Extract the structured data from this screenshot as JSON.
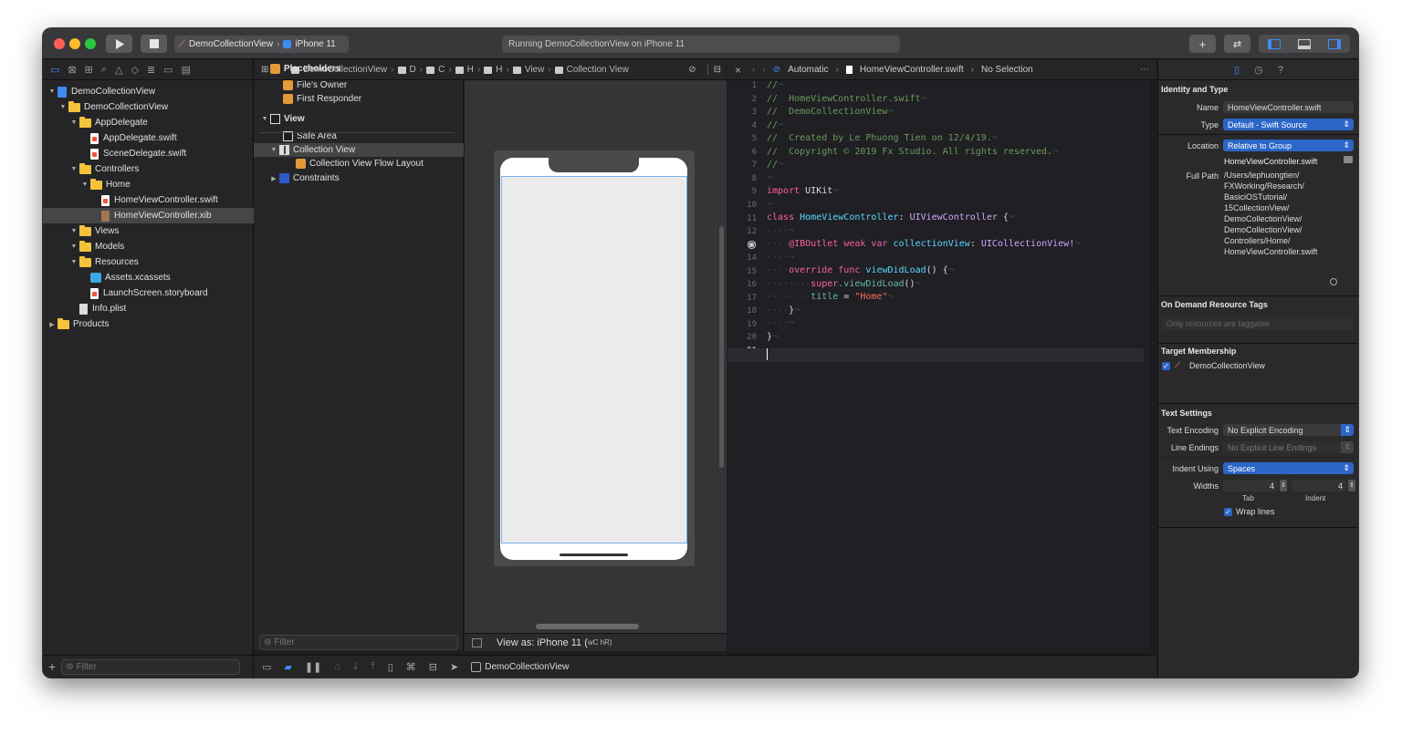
{
  "toolbar": {
    "scheme": "DemoCollectionView",
    "device": "iPhone 11",
    "status": "Running DemoCollectionView on iPhone 11",
    "add_label": "+",
    "play_icon": "play-icon",
    "stop_icon": "stop-icon"
  },
  "navigator": {
    "items": [
      {
        "label": "DemoCollectionView",
        "kind": "project"
      },
      {
        "label": "DemoCollectionView",
        "kind": "folder"
      },
      {
        "label": "AppDelegate",
        "kind": "folder"
      },
      {
        "label": "AppDelegate.swift",
        "kind": "swift"
      },
      {
        "label": "SceneDelegate.swift",
        "kind": "swift"
      },
      {
        "label": "Controllers",
        "kind": "folder"
      },
      {
        "label": "Home",
        "kind": "folder"
      },
      {
        "label": "HomeViewController.swift",
        "kind": "swift"
      },
      {
        "label": "HomeViewController.xib",
        "kind": "xib",
        "selected": true
      },
      {
        "label": "Views",
        "kind": "folder"
      },
      {
        "label": "Models",
        "kind": "folder"
      },
      {
        "label": "Resources",
        "kind": "folder"
      },
      {
        "label": "Assets.xcassets",
        "kind": "assets"
      },
      {
        "label": "LaunchScreen.storyboard",
        "kind": "swift"
      },
      {
        "label": "Info.plist",
        "kind": "plist"
      },
      {
        "label": "Products",
        "kind": "folder"
      }
    ],
    "filter_placeholder": "Filter"
  },
  "ib": {
    "breadcrumb": [
      "DemoCollectionView",
      "D",
      "C",
      "H",
      "H",
      "View",
      "Collection View"
    ],
    "outline": [
      {
        "label": "Placeholders",
        "bold": true
      },
      {
        "label": "File's Owner"
      },
      {
        "label": "First Responder"
      },
      {
        "label": "View",
        "bold": true
      },
      {
        "label": "Safe Area"
      },
      {
        "label": "Collection View",
        "selected": true
      },
      {
        "label": "Collection View Flow Layout"
      },
      {
        "label": "Constraints"
      }
    ],
    "filter_placeholder": "Filter",
    "view_as": "View as: iPhone 11 (",
    "view_as_size": "wC hR)"
  },
  "editor": {
    "jump_mode": "Automatic",
    "file": "HomeViewController.swift",
    "selection": "No Selection",
    "line_numbers": [
      "1",
      "2",
      "3",
      "4",
      "5",
      "6",
      "7",
      "8",
      "9",
      "10",
      "11",
      "12",
      "13",
      "14",
      "15",
      "16",
      "17",
      "18",
      "19",
      "20",
      "21"
    ],
    "comments": {
      "l1": "//",
      "l2": "//  HomeViewController.swift",
      "l3": "//  DemoCollectionView",
      "l4": "//",
      "l5": "//  Created by Le Phuong Tien on 12/4/19.",
      "l6": "//  Copyright © 2019 Fx Studio. All rights reserved.",
      "l7": "//"
    },
    "code": {
      "import_kw": "import",
      "import_mod": "UIKit",
      "class_kw": "class",
      "class_name": "HomeViewController",
      "super_class": "UIViewController",
      "brace_open": " {",
      "outlet": "@IBOutlet",
      "weak_var": "weak var",
      "outlet_name": "collectionView",
      "outlet_type": "UICollectionView!",
      "override_func": "override func",
      "method": "viewDidLoad",
      "parens": "() {",
      "super_kw": "super",
      "super_call": ".viewDidLoad",
      "call_parens": "()",
      "title_prop": "title",
      "assign": " = ",
      "title_value": "\"Home\"",
      "close_inner": "}",
      "close_outer": "}"
    }
  },
  "inspector": {
    "identity_header": "Identity and Type",
    "name_label": "Name",
    "name_value": "HomeViewController.swift",
    "type_label": "Type",
    "type_value": "Default - Swift Source",
    "location_label": "Location",
    "location_value": "Relative to Group",
    "location_file": "HomeViewController.swift",
    "full_path_label": "Full Path",
    "full_path": [
      "/Users/lephuongtien/",
      "FXWorking/Research/",
      "BasiciOSTutorial/",
      "15CollectionView/",
      "DemoCollectionView/",
      "DemoCollectionView/",
      "Controllers/Home/",
      "HomeViewController.swift"
    ],
    "odr_header": "On Demand Resource Tags",
    "odr_placeholder": "Only resources are taggable",
    "membership_header": "Target Membership",
    "membership_target": "DemoCollectionView",
    "text_header": "Text Settings",
    "encoding_label": "Text Encoding",
    "encoding_value": "No Explicit Encoding",
    "endings_label": "Line Endings",
    "endings_value": "No Explicit Line Endings",
    "indent_label": "Indent Using",
    "indent_value": "Spaces",
    "widths_label": "Widths",
    "tab_value": "4",
    "indent_width_value": "4",
    "tab_label": "Tab",
    "indent_sub_label": "Indent",
    "wrap_label": "Wrap lines"
  },
  "bottom": {
    "target": "DemoCollectionView"
  },
  "colors": {
    "accent": "#2c66c8",
    "keyword": "#fc5fa3",
    "comment": "#6c9c5a",
    "type": "#5dd8ff",
    "string": "#fc6a5d",
    "folder": "#f5c33b"
  }
}
